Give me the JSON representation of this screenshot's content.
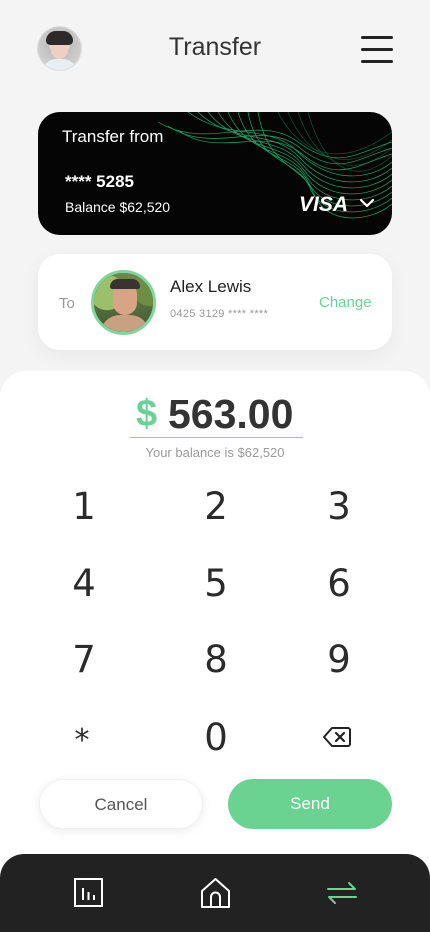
{
  "header": {
    "title": "Transfer"
  },
  "source_card": {
    "label": "Transfer from",
    "masked_number": "**** 5285",
    "balance": "Balance $62,520",
    "brand": "VISA"
  },
  "recipient": {
    "to_label": "To",
    "name": "Alex Lewis",
    "phone": "0425 3129 **** ****",
    "change_label": "Change"
  },
  "amount": {
    "currency": "$",
    "value": "563.00",
    "balance_note": "Your balance is $62,520"
  },
  "keypad": {
    "keys": [
      "1",
      "2",
      "3",
      "4",
      "5",
      "6",
      "7",
      "8",
      "9",
      "*",
      "0"
    ]
  },
  "actions": {
    "cancel_label": "Cancel",
    "send_label": "Send"
  },
  "nav": {
    "items": [
      {
        "icon": "chart-icon",
        "active": false
      },
      {
        "icon": "home-icon",
        "active": false
      },
      {
        "icon": "transfer-icon",
        "active": true
      }
    ]
  },
  "colors": {
    "accent": "#6AD391",
    "card_background": "#050505",
    "navbar_background": "#222222",
    "page_background": "#F4F4F4"
  }
}
